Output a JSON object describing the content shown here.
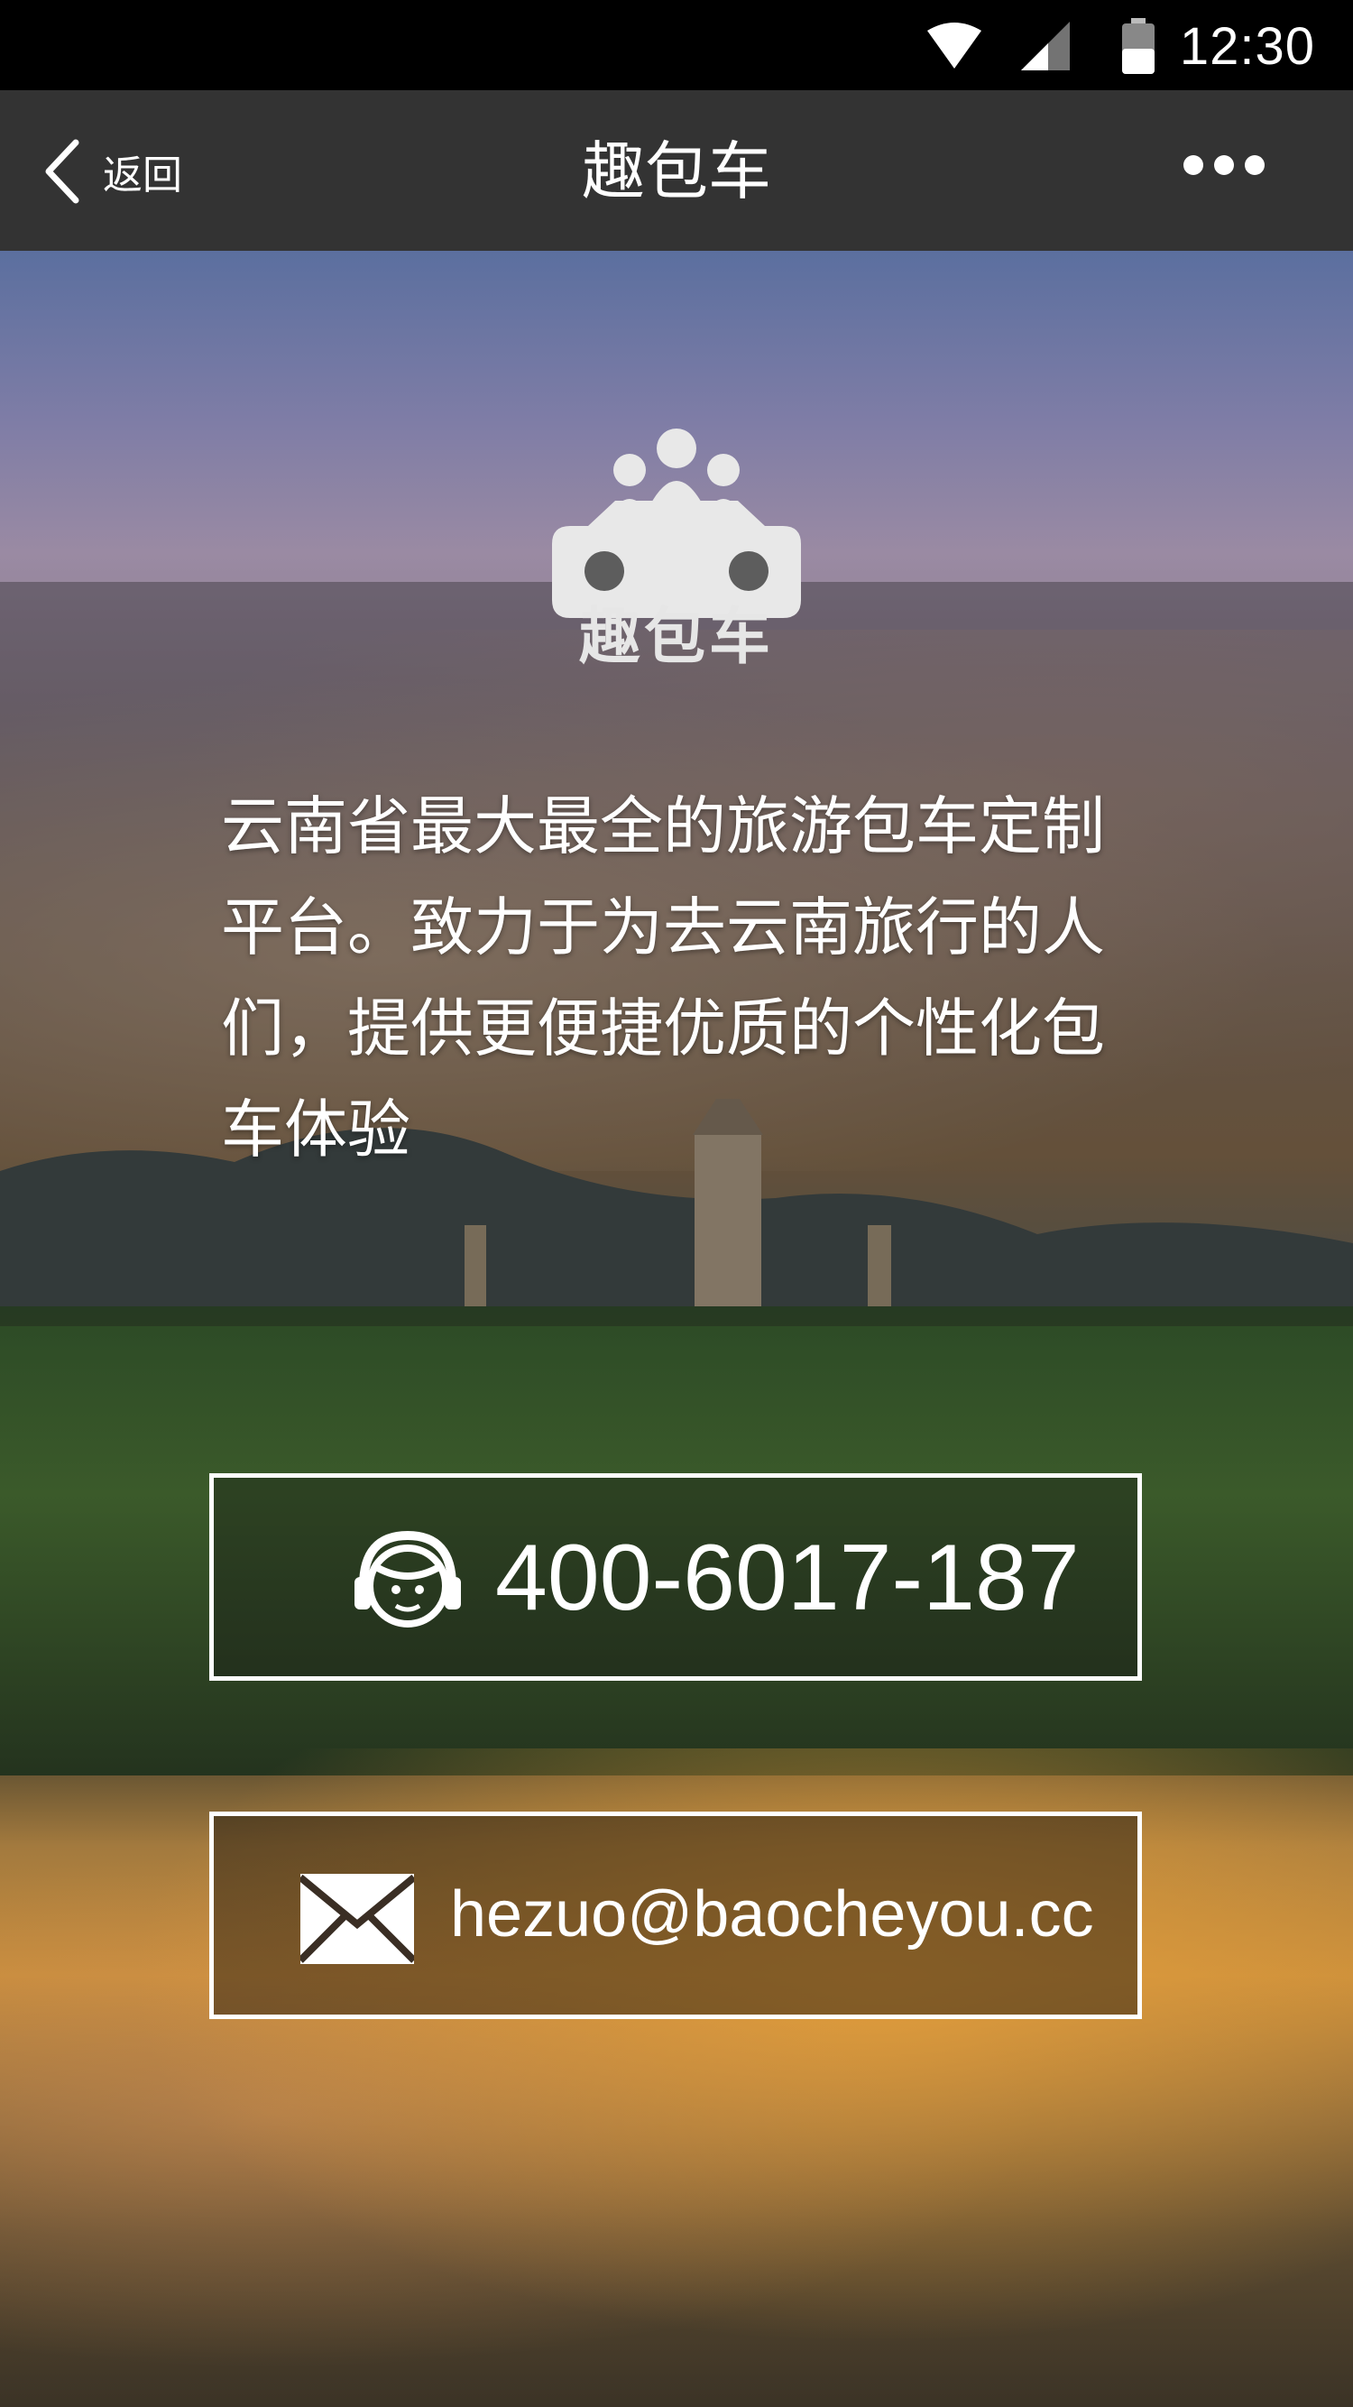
{
  "status_bar": {
    "time": "12:30",
    "icons": [
      "wifi-icon",
      "cell-signal-icon",
      "battery-icon"
    ]
  },
  "nav": {
    "back_label": "返回",
    "title": "趣包车",
    "more_icon": "more-dots-icon"
  },
  "logo": {
    "icon": "car-with-passengers-icon",
    "text": "趣包车"
  },
  "description": "云南省最大最全的旅游包车定制平台。致力于为去云南旅行的人们，提供更便捷优质的个性化包车体验",
  "contacts": {
    "phone": {
      "icon": "customer-service-headset-icon",
      "value": "400-6017-187"
    },
    "email": {
      "icon": "envelope-icon",
      "value": "hezuo@baocheyou.cc"
    }
  },
  "colors": {
    "status_bar": "#000000",
    "nav_bar": "#333333",
    "text": "#ffffff"
  }
}
